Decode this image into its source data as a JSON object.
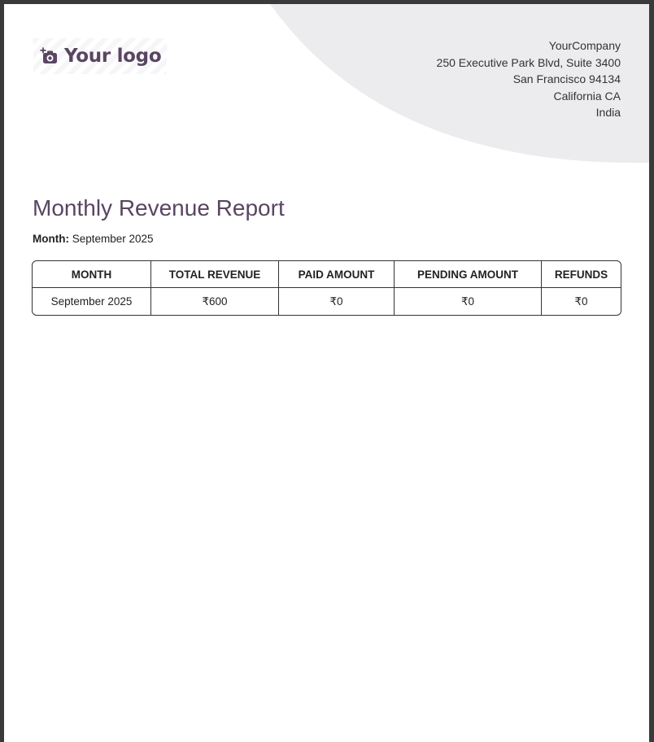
{
  "colors": {
    "accent": "#5a4562",
    "header_curve": "#ecebee",
    "viewer_frame": "#3a3a3a"
  },
  "logo": {
    "icon": "camera-plus-icon",
    "text": "Your logo"
  },
  "company": {
    "name": "YourCompany",
    "street": "250 Executive Park Blvd, Suite 3400",
    "city_zip": "San Francisco 94134",
    "state": "California CA",
    "country": "India"
  },
  "report": {
    "title": "Monthly Revenue Report",
    "month_label": "Month:",
    "month_value": "September 2025"
  },
  "table": {
    "headers": [
      "MONTH",
      "TOTAL REVENUE",
      "PAID AMOUNT",
      "PENDING AMOUNT",
      "REFUNDS"
    ],
    "rows": [
      [
        "September 2025",
        "₹600",
        "₹0",
        "₹0",
        "₹0"
      ]
    ]
  }
}
